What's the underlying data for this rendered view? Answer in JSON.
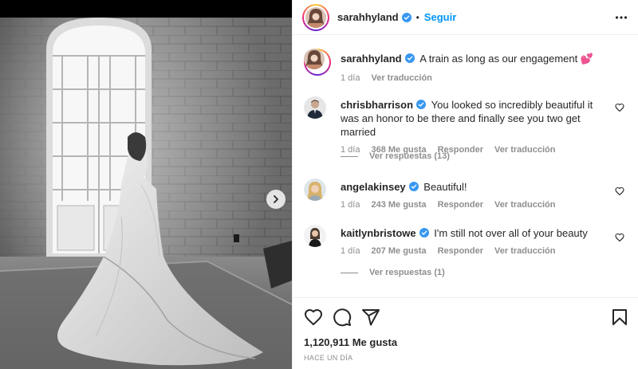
{
  "post": {
    "author": "sarahhyland",
    "follow_label": "Seguir",
    "dot": "•",
    "caption": "A train as long as our engagement",
    "caption_emoji": "💕",
    "caption_time": "1 día",
    "caption_translate": "Ver traducción",
    "likes": "1,120,911 Me gusta",
    "date": "HACE UN DÍA"
  },
  "comments": [
    {
      "user": "chrisbharrison",
      "text": "You looked so incredibly beautiful it was an honor to be there and finally see you two get married",
      "time": "1 día",
      "likes": "368 Me gusta",
      "reply": "Responder",
      "translate": "Ver traducción",
      "replies": "Ver respuestas (13)"
    },
    {
      "user": "angelakinsey",
      "text": "Beautiful!",
      "time": "1 día",
      "likes": "243 Me gusta",
      "reply": "Responder",
      "translate": "Ver traducción"
    },
    {
      "user": "kaitlynbristowe",
      "text": "I'm still not over all of your beauty",
      "time": "1 día",
      "likes": "207 Me gusta",
      "reply": "Responder",
      "translate": "Ver traducción",
      "replies": "Ver respuestas (1)"
    }
  ],
  "icons": {
    "like": "heart-icon",
    "comment": "comment-icon",
    "share": "send-icon",
    "save": "bookmark-icon",
    "more": "more-options-icon",
    "next": "chevron-right-icon",
    "verified": "verified-badge-icon"
  },
  "colors": {
    "accent": "#0095f6",
    "text": "#262626",
    "muted": "#8e8e8e",
    "divider": "#efefef"
  }
}
